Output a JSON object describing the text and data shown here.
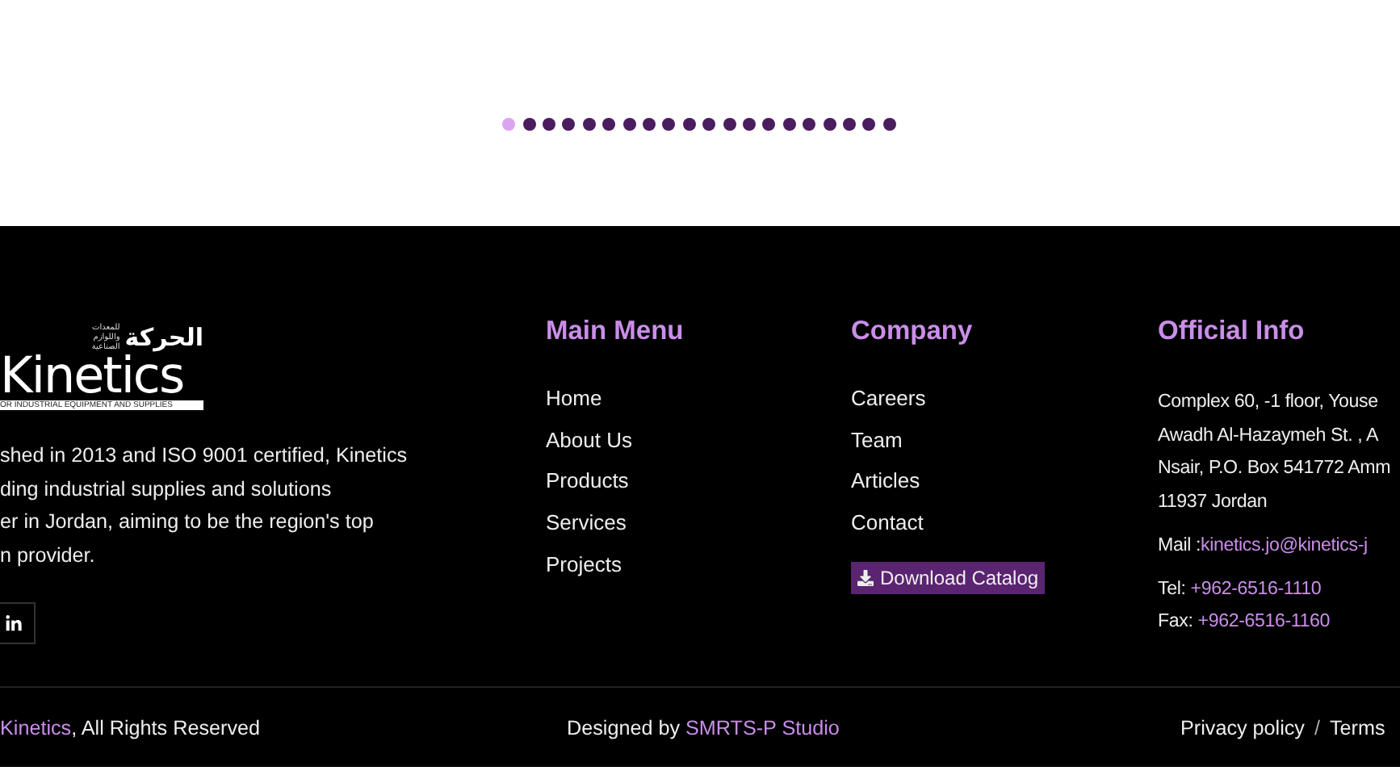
{
  "carousel_dots": [
    {
      "selected": true
    },
    {
      "selected": false
    },
    {
      "selected": false
    },
    {
      "selected": false
    },
    {
      "selected": false
    },
    {
      "selected": false
    },
    {
      "selected": false
    },
    {
      "selected": false
    },
    {
      "selected": false
    },
    {
      "selected": false
    },
    {
      "selected": false
    },
    {
      "selected": false
    },
    {
      "selected": false
    },
    {
      "selected": false
    },
    {
      "selected": false
    },
    {
      "selected": false
    },
    {
      "selected": false
    },
    {
      "selected": false
    },
    {
      "selected": false
    },
    {
      "selected": false
    }
  ],
  "about": {
    "logo": {
      "arabic_name": "الحركة",
      "arabic_tagline": "للمعدات واللوازم الصناعية",
      "name": "Kinetics",
      "tagline": "OR INDUSTRIAL EQUIPMENT AND SUPPLIES"
    },
    "lines": [
      "shed in 2013 and ISO 9001 certified, Kinetics",
      "ding industrial supplies and solutions",
      "er in Jordan, aiming to be the region's top",
      "n provider."
    ]
  },
  "main_menu": {
    "title": "Main Menu",
    "links": [
      "Home",
      "About Us",
      "Products",
      "Services",
      "Projects"
    ]
  },
  "company": {
    "title": "Company",
    "links": [
      "Careers",
      "Team",
      "Articles",
      "Contact"
    ],
    "button": "Download Catalog"
  },
  "official_info": {
    "title": "Official Info",
    "address": [
      "Complex 60, -1 floor, Youse",
      "Awadh Al-Hazaymeh St. , A",
      "Nsair, P.O. Box 541772 Amm",
      "11937 Jordan"
    ],
    "mail": {
      "label": "Mail :",
      "value": "kinetics.jo@kinetics-j"
    },
    "tel": {
      "label": "Tel: ",
      "value": "+962-6516-1110"
    },
    "fax": {
      "label": "Fax: ",
      "value": "+962-6516-1160"
    }
  },
  "bottom_bar": {
    "copyright_link": "Kinetics",
    "copyright_text": ", All Rights Reserved",
    "designed_label": "Designed by ",
    "designer_link": "SMRTS-P Studio",
    "legal_links": [
      "Privacy policy",
      "Terms"
    ],
    "separator": "/"
  }
}
